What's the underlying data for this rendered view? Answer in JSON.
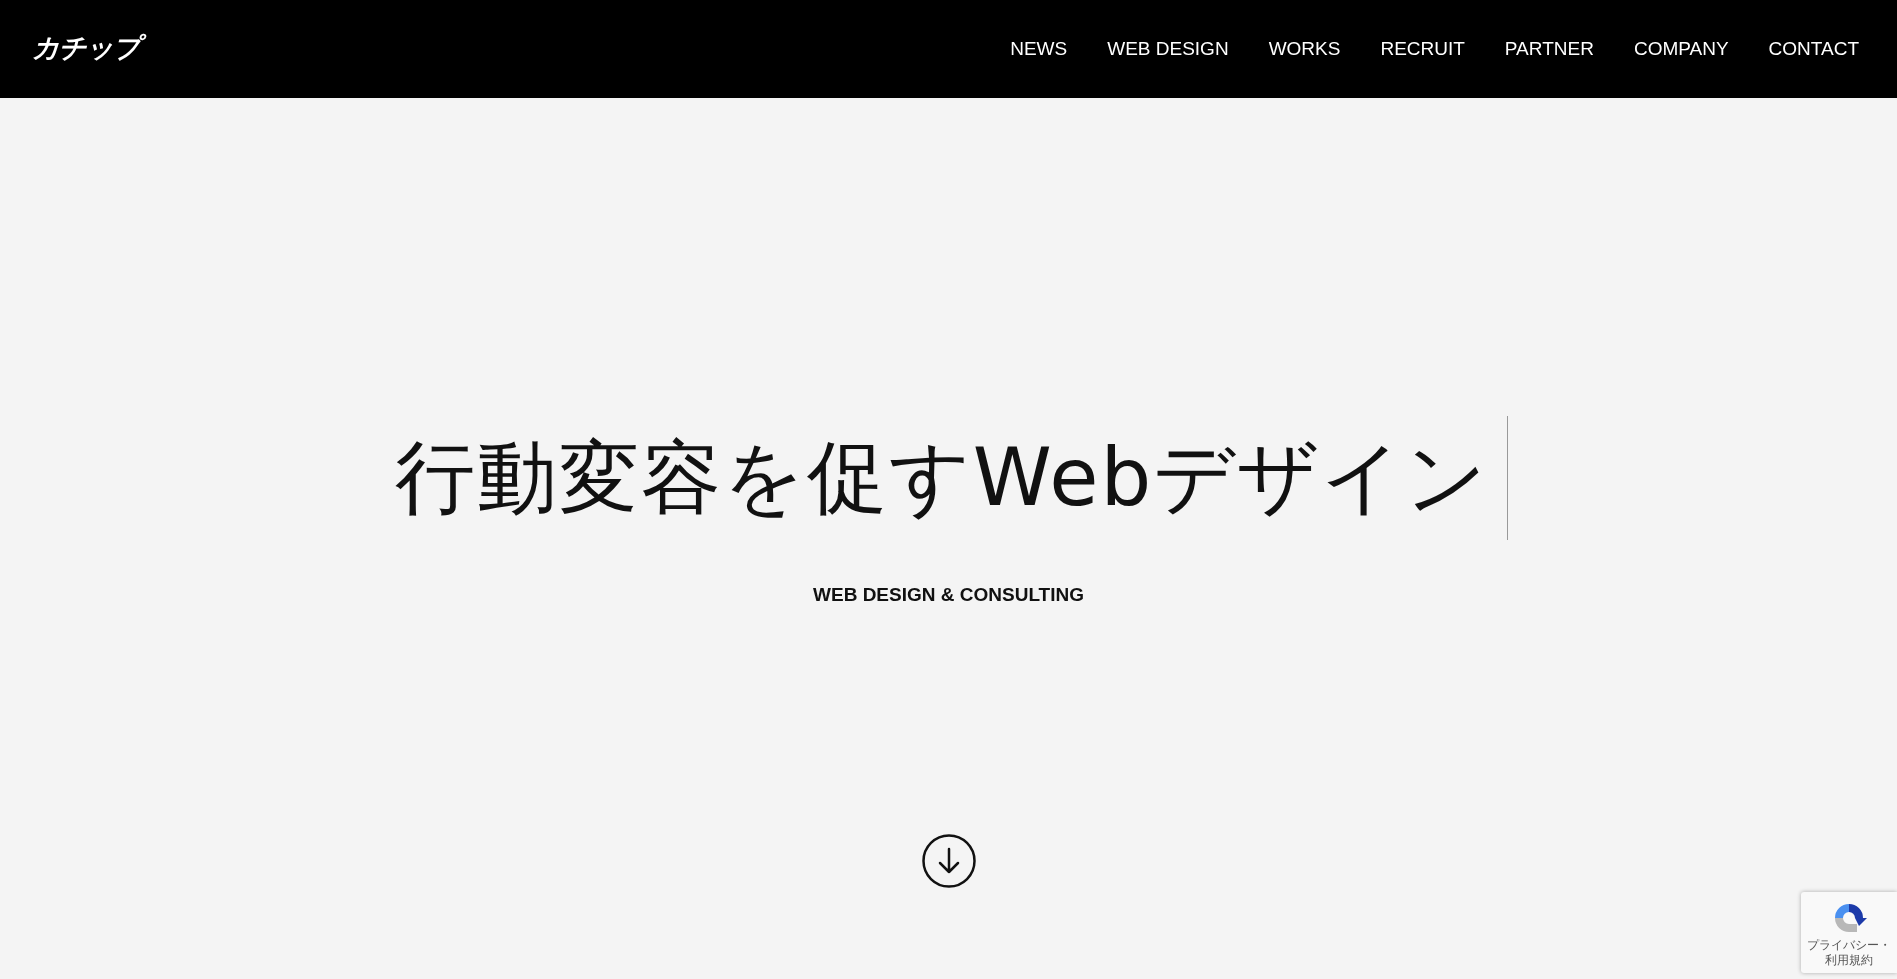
{
  "header": {
    "logo": "カチップ",
    "nav": [
      {
        "label": "NEWS"
      },
      {
        "label": "WEB DESIGN"
      },
      {
        "label": "WORKS"
      },
      {
        "label": "RECRUIT"
      },
      {
        "label": "PARTNER"
      },
      {
        "label": "COMPANY"
      },
      {
        "label": "CONTACT"
      }
    ]
  },
  "hero": {
    "heading": "行動変容を促すWebデザイン",
    "subheading": "WEB DESIGN & CONSULTING"
  },
  "recaptcha": {
    "links": "プライバシー・利用規約"
  }
}
